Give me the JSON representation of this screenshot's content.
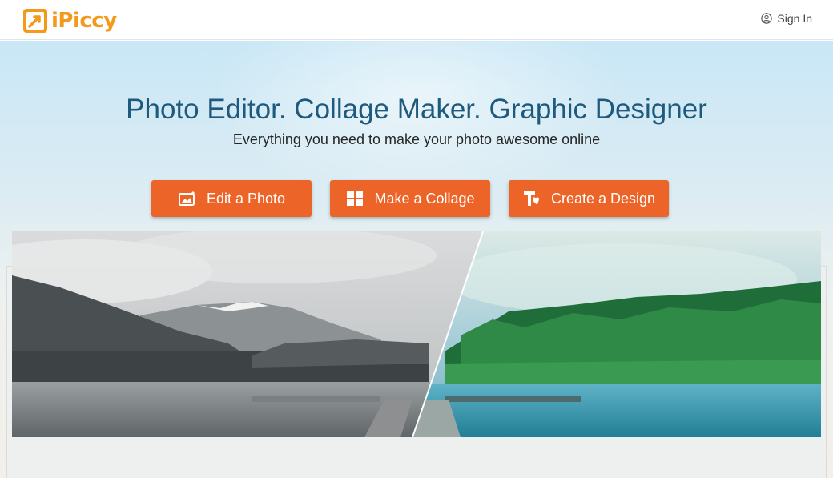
{
  "header": {
    "logo_text": "iPiccy",
    "signin_label": "Sign In"
  },
  "hero": {
    "title": "Photo Editor. Collage Maker. Graphic Designer",
    "subtitle": "Everything you need to make your photo awesome online",
    "buttons": [
      {
        "label": "Edit a Photo",
        "icon": "photo-edit-icon"
      },
      {
        "label": "Make a Collage",
        "icon": "collage-grid-icon"
      },
      {
        "label": "Create a Design",
        "icon": "design-text-icon"
      }
    ]
  },
  "colors": {
    "brand_orange": "#f39a1c",
    "button_orange": "#ec6427",
    "title_blue": "#1e5a7e"
  }
}
